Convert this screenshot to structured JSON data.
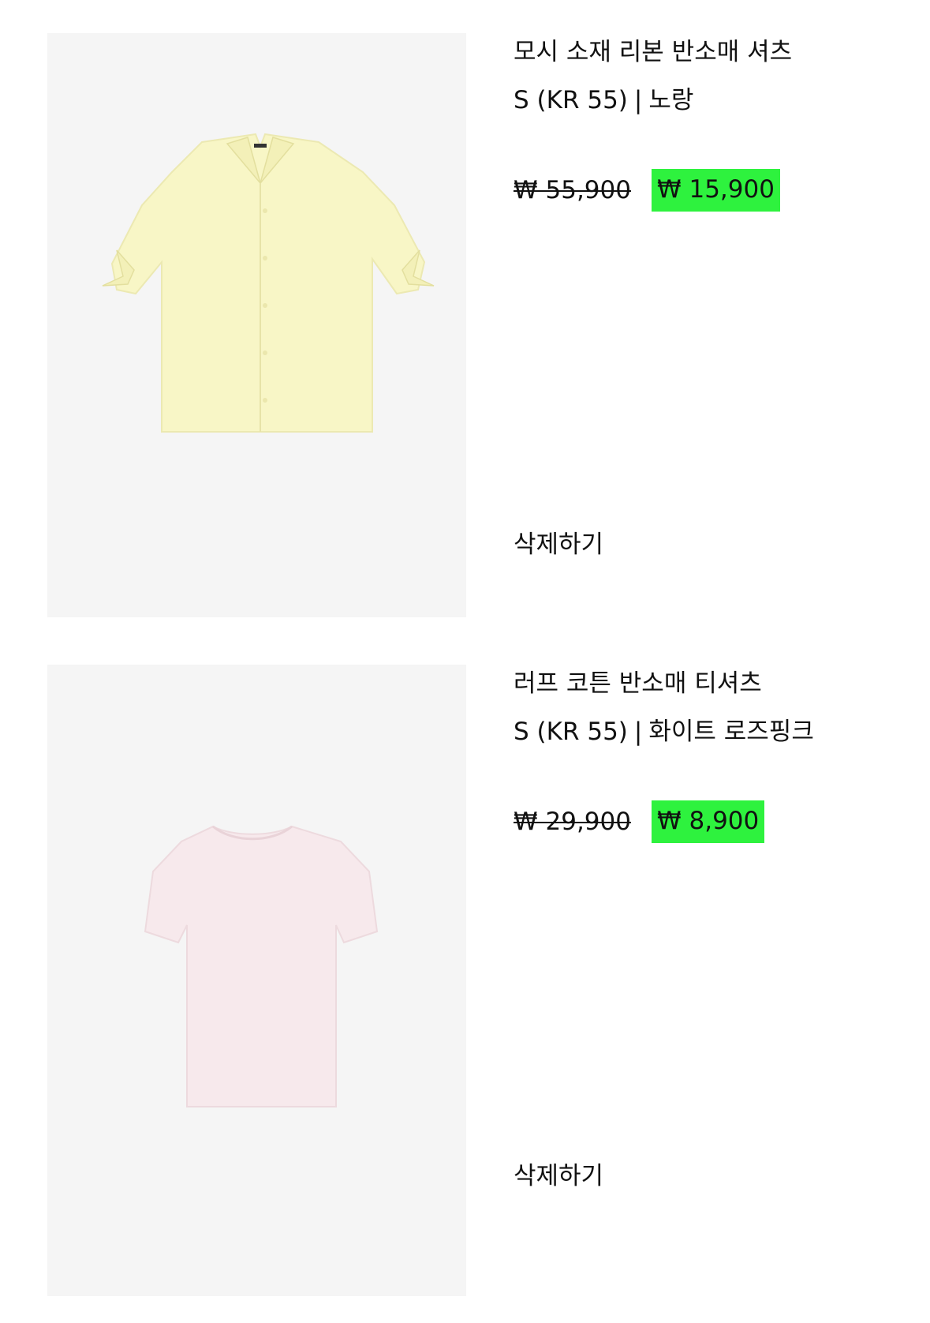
{
  "cart": {
    "items": [
      {
        "product_image_icon": "yellow-short-sleeve-ribbon-shirt",
        "name": "모시 소재 리본 반소매 셔츠",
        "size": "S (KR 55)",
        "separator": "|",
        "color": "노랑",
        "original_price": "₩ 55,900",
        "sale_price": "₩ 15,900",
        "delete_label": "삭제하기"
      },
      {
        "product_image_icon": "white-rose-pink-short-sleeve-tshirt",
        "name": "러프 코튼 반소매 티셔츠",
        "size": "S (KR 55)",
        "separator": "|",
        "color": "화이트 로즈핑크",
        "original_price": "₩ 29,900",
        "sale_price": "₩ 8,900",
        "delete_label": "삭제하기"
      }
    ],
    "colors": {
      "image_background": "#f5f5f5",
      "sale_highlight": "#2ef23e",
      "text": "#111111",
      "shirt_fill": "#f8f6c6",
      "tshirt_fill": "#f7e9ec"
    }
  }
}
